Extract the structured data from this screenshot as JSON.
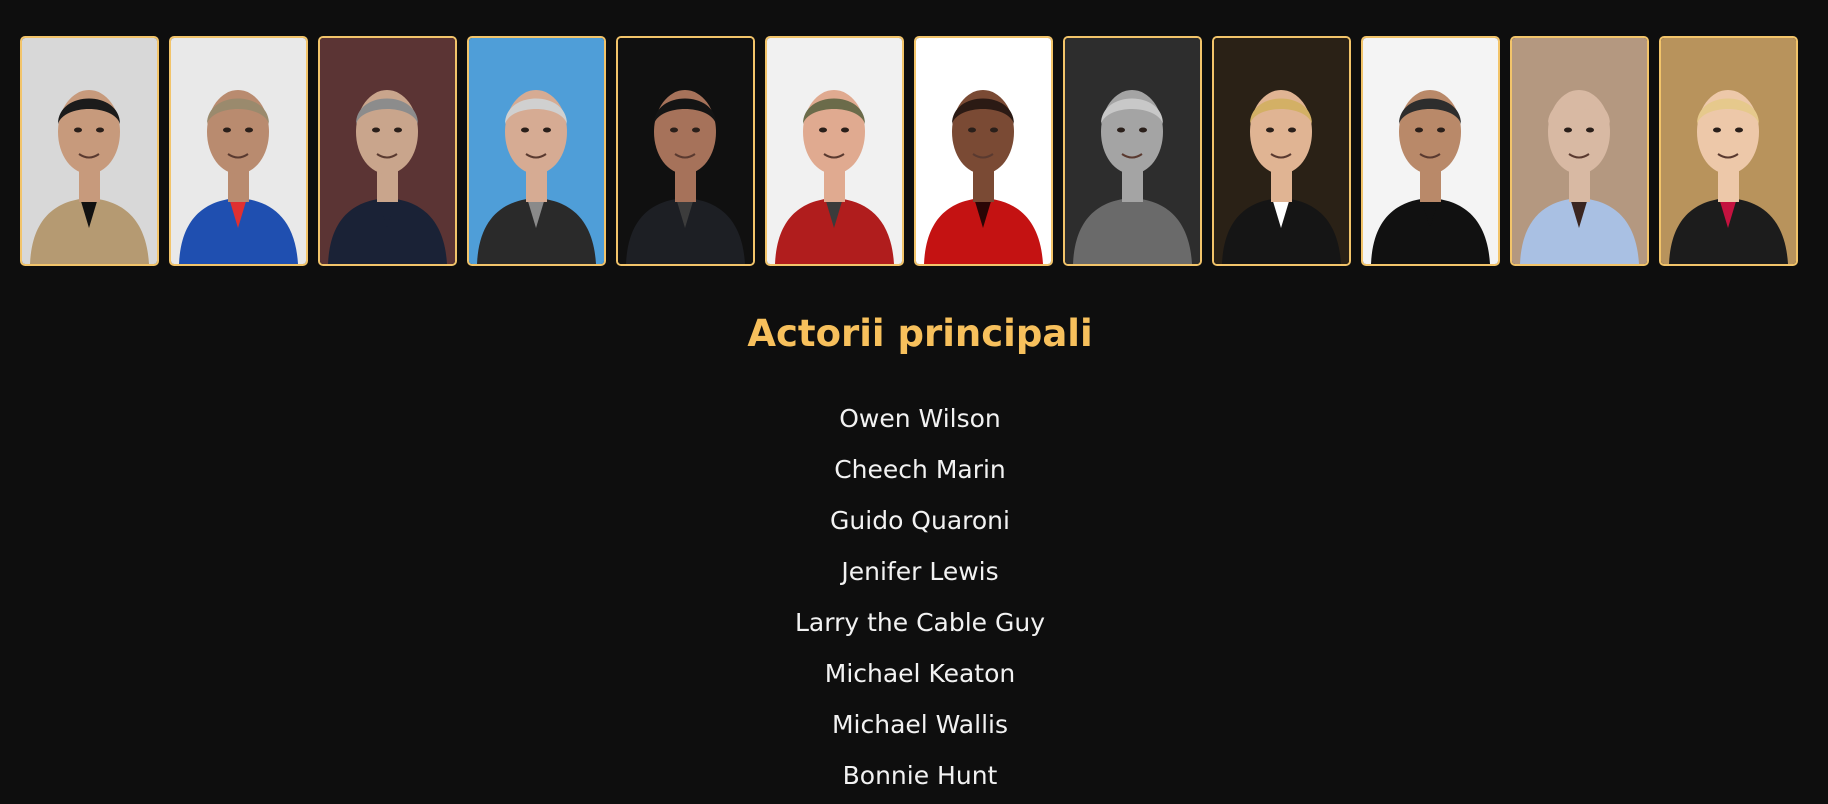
{
  "cast_section": {
    "title": "Actorii principali",
    "actors": [
      "Owen Wilson",
      "Cheech Marin",
      "Guido Quaroni",
      "Jenifer Lewis",
      "Larry the Cable Guy",
      "Michael Keaton",
      "Michael Wallis",
      "Bonnie Hunt"
    ]
  },
  "photos": [
    {
      "name": "actor-photo-1",
      "bg": "#d8d8d8",
      "skin": "#c79a7c",
      "hair": "#1b1b1b",
      "shirt": "#b59a72",
      "accent": "#111111"
    },
    {
      "name": "actor-photo-2",
      "bg": "#e9e9e9",
      "skin": "#b98b6f",
      "hair": "#9a8a6d",
      "shirt": "#1f4fb0",
      "accent": "#e03030"
    },
    {
      "name": "actor-photo-3",
      "bg": "#5b3434",
      "skin": "#c9a58c",
      "hair": "#8c8c8c",
      "shirt": "#1a2236",
      "accent": "#1a2236"
    },
    {
      "name": "actor-photo-4",
      "bg": "#4f9ed8",
      "skin": "#d6ab93",
      "hair": "#d0d0d0",
      "shirt": "#2a2a2a",
      "accent": "#8a8a8a"
    },
    {
      "name": "actor-photo-5",
      "bg": "#101010",
      "skin": "#a6725a",
      "hair": "#141414",
      "shirt": "#1d1f24",
      "accent": "#3c3c3c"
    },
    {
      "name": "actor-photo-6",
      "bg": "#f1f1f1",
      "skin": "#e0aa90",
      "hair": "#6b6b4a",
      "shirt": "#b01d1d",
      "accent": "#3b3b3b"
    },
    {
      "name": "actor-photo-7",
      "bg": "#ffffff",
      "skin": "#7a4a34",
      "hair": "#2b1a14",
      "shirt": "#c41212",
      "accent": "#2a0505"
    },
    {
      "name": "actor-photo-8",
      "bg": "#2d2d2d",
      "skin": "#a4a4a4",
      "hair": "#c8c8c8",
      "shirt": "#6a6a6a",
      "accent": "#6a6a6a"
    },
    {
      "name": "actor-photo-9",
      "bg": "#2a2116",
      "skin": "#e0b493",
      "hair": "#d3b065",
      "shirt": "#151515",
      "accent": "#ffffff"
    },
    {
      "name": "actor-photo-10",
      "bg": "#f4f4f4",
      "skin": "#b98969",
      "hair": "#2d2d2d",
      "shirt": "#111111",
      "accent": "#111111"
    },
    {
      "name": "actor-photo-11",
      "bg": "#b49880",
      "skin": "#d8b9a3",
      "hair": "#d8b9a3",
      "shirt": "#a9c0e3",
      "accent": "#3a2520"
    },
    {
      "name": "actor-photo-12",
      "bg": "#b8935c",
      "skin": "#edc8a9",
      "hair": "#e6c98c",
      "shirt": "#1c1c1c",
      "accent": "#c4123f"
    }
  ]
}
